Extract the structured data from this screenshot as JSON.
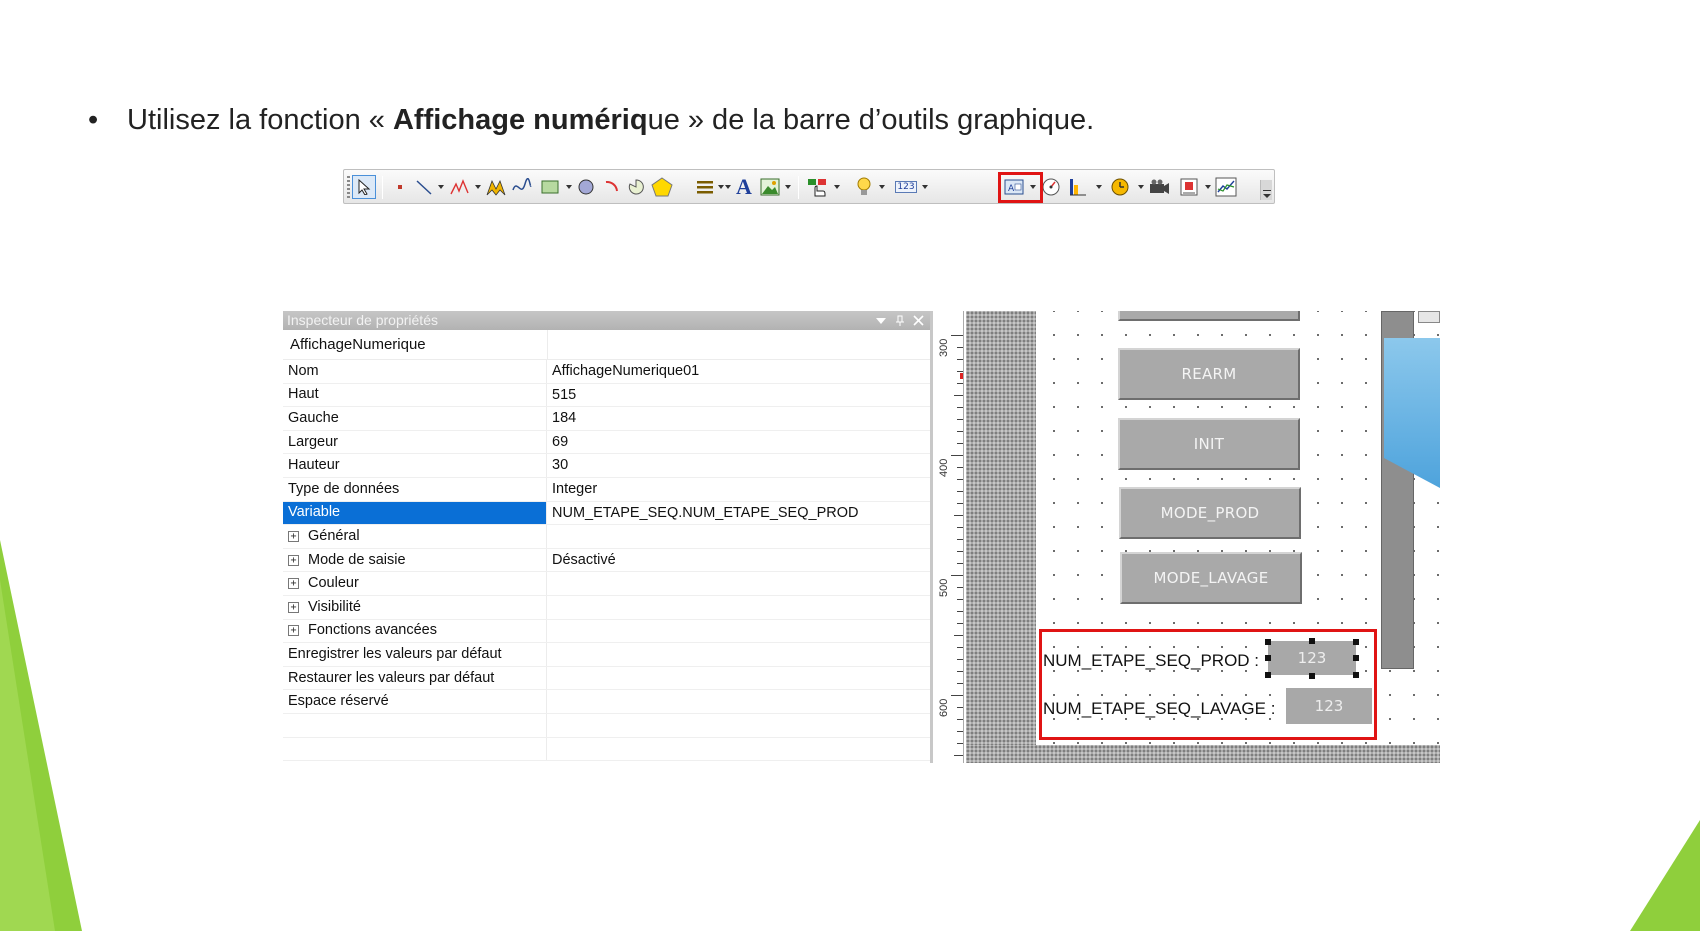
{
  "slide": {
    "bullet": "•",
    "instruction_pre": "Utilisez la fonction « ",
    "instruction_bold": "Affichage numériq",
    "instruction_post": "ue » de la barre d’outils graphique."
  },
  "toolbar": {
    "icons": [
      "select-arrow-icon",
      "point-icon",
      "line-icon",
      "polyline-icon",
      "zigzag-icon",
      "curve-icon",
      "rectangle-icon",
      "ellipse-icon",
      "arc-icon",
      "pie-icon",
      "polygon-icon",
      "lines-style-icon",
      "text-icon",
      "image-icon",
      "button-icon",
      "light-bulb-icon",
      "numeric-display-icon",
      "alphanumeric-display-icon",
      "gauge-icon",
      "bargraph-icon",
      "clock-icon",
      "camera-icon",
      "report-icon",
      "trend-icon"
    ],
    "text_icon_glyph": "A",
    "numeric_icon_glyph": "123"
  },
  "inspector": {
    "title": "Inspecteur de propriétés",
    "object_name": "AffichageNumerique",
    "rows": [
      {
        "key": "Nom",
        "value": "AffichageNumerique01"
      },
      {
        "key": "Haut",
        "value": "515"
      },
      {
        "key": "Gauche",
        "value": "184"
      },
      {
        "key": "Largeur",
        "value": "69"
      },
      {
        "key": "Hauteur",
        "value": "30"
      },
      {
        "key": "Type de données",
        "value": "Integer"
      },
      {
        "key": "Variable",
        "value": "NUM_ETAPE_SEQ.NUM_ETAPE_SEQ_PROD"
      },
      {
        "key": "Général",
        "value": ""
      },
      {
        "key": "Mode de saisie",
        "value": "Désactivé"
      },
      {
        "key": "Couleur",
        "value": ""
      },
      {
        "key": "Visibilité",
        "value": ""
      },
      {
        "key": "Fonctions avancées",
        "value": ""
      },
      {
        "key": "Enregistrer les valeurs par défaut",
        "value": ""
      },
      {
        "key": "Restaurer les valeurs par défaut",
        "value": ""
      },
      {
        "key": "Espace réservé",
        "value": ""
      }
    ],
    "selected_row": "Variable",
    "expand_glyph": "+"
  },
  "ruler": {
    "labels": [
      "300",
      "400",
      "500",
      "600"
    ]
  },
  "editor": {
    "buttons": [
      "REARM",
      "INIT",
      "MODE_PROD",
      "MODE_LAVAGE"
    ],
    "label_prod": "NUM_ETAPE_SEQ_PROD :",
    "label_lavage": "NUM_ETAPE_SEQ_LAVAGE :",
    "value_prod": "123",
    "value_lavage": "123"
  },
  "colors": {
    "highlight_red": "#e01414",
    "selection_blue": "#0a6fd6",
    "deco_green": "#8fcf3c"
  }
}
